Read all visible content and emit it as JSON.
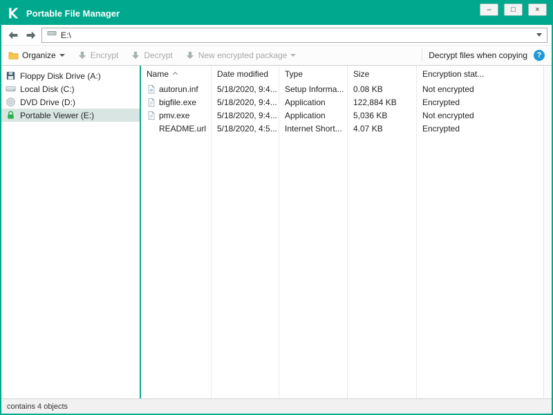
{
  "window": {
    "title": "Portable File Manager",
    "controls": {
      "minimize": "–",
      "maximize": "□",
      "close": "×"
    }
  },
  "navbar": {
    "address": "E:\\"
  },
  "toolbar": {
    "organize_label": "Organize",
    "encrypt_label": "Encrypt",
    "decrypt_label": "Decrypt",
    "new_package_label": "New encrypted package",
    "decrypt_when_copying_label": "Decrypt files when copying",
    "help_glyph": "?"
  },
  "sidebar": {
    "items": [
      {
        "label": "Floppy Disk Drive (A:)",
        "icon": "floppy-disk-icon",
        "selected": false
      },
      {
        "label": "Local Disk (C:)",
        "icon": "hard-disk-icon",
        "selected": false
      },
      {
        "label": "DVD Drive (D:)",
        "icon": "dvd-icon",
        "selected": false
      },
      {
        "label": "Portable Viewer (E:)",
        "icon": "green-lock-icon",
        "selected": true
      }
    ]
  },
  "filelist": {
    "columns": [
      "Name",
      "Date modified",
      "Type",
      "Size",
      "Encryption stat..."
    ],
    "sort": {
      "column": "Name",
      "ascending": true
    },
    "rows": [
      {
        "name": "autorun.inf",
        "icon": "setup-information-file-icon",
        "date": "5/18/2020, 9:4...",
        "type": "Setup Informa...",
        "size": "0.08 KB",
        "encryption": "Not encrypted"
      },
      {
        "name": "bigfile.exe",
        "icon": "application-file-icon",
        "date": "5/18/2020, 9:4...",
        "type": "Application",
        "size": "122,884 KB",
        "encryption": "Encrypted"
      },
      {
        "name": "pmv.exe",
        "icon": "application-file-icon",
        "date": "5/18/2020, 9:4...",
        "type": "Application",
        "size": "5,036 KB",
        "encryption": "Not encrypted"
      },
      {
        "name": "README.url",
        "icon": null,
        "date": "5/18/2020, 4:5...",
        "type": "Internet Short...",
        "size": "4.07 KB",
        "encryption": "Encrypted"
      }
    ]
  },
  "statusbar": {
    "text": "contains 4 objects"
  },
  "colors": {
    "brand_teal": "#00a88e",
    "help_blue": "#1e9bd7",
    "selected_row": "#d8e5e2"
  }
}
